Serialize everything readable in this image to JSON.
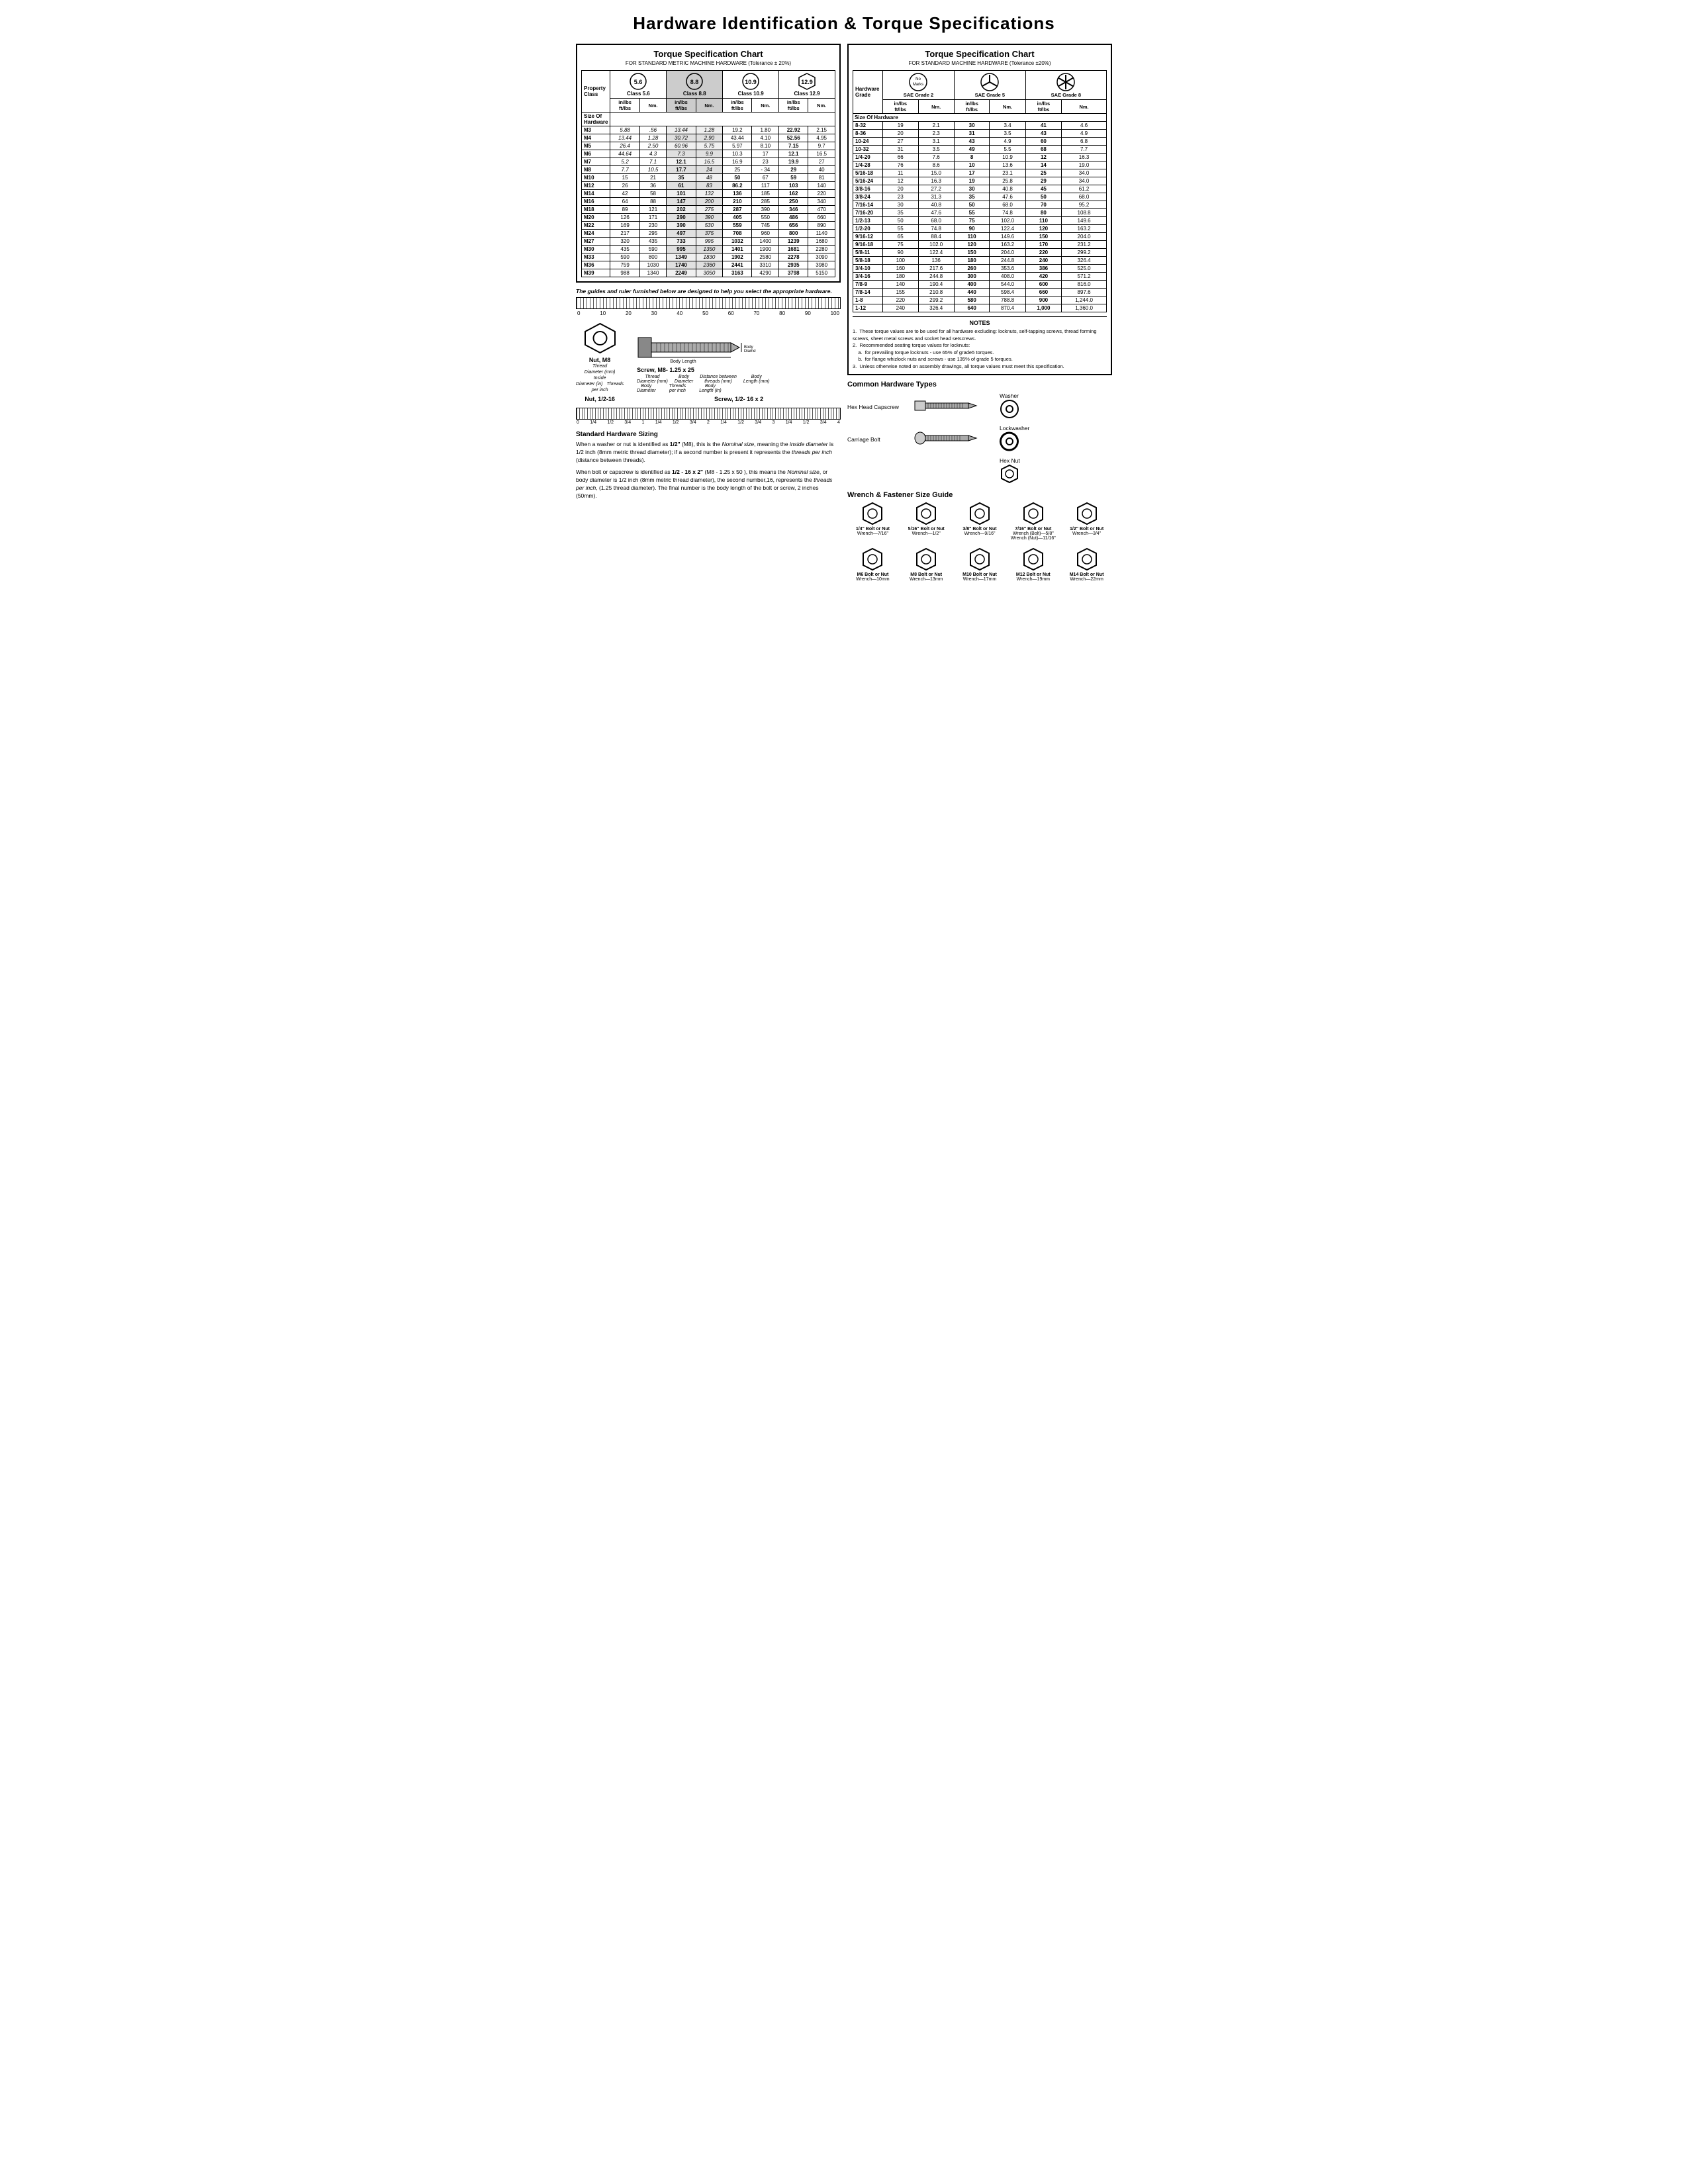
{
  "title": "Hardware Identification  &  Torque Specifications",
  "left_chart": {
    "title": "Torque Specification Chart",
    "subtitle": "FOR STANDARD METRIC MACHINE HARDWARE (Tolerance ± 20%)",
    "columns": {
      "property_class": "Property\nClass",
      "size_of_hardware": "Size Of\nHardware",
      "class56_inlbs": "in/lbs\nft/lbs",
      "class56_nm": "Nm.",
      "class88_inlbs": "in/lbs\nft/lbs",
      "class88_nm": "Nm.",
      "class109_inlbs": "in/lbs\nft/lbs",
      "class109_nm": "Nm.",
      "class129_inlbs": "in/lbs\nft/lbs",
      "class129_nm": "Nm."
    },
    "classes": [
      {
        "label": "5.6",
        "sub": "Class 5.6"
      },
      {
        "label": "8.8",
        "sub": "Class 8.8"
      },
      {
        "label": "10.9",
        "sub": "Class 10.9"
      },
      {
        "label": "12.9",
        "sub": "Class 12.9"
      }
    ],
    "rows": [
      {
        "size": "M3",
        "c56_ft": "5.88",
        "c56_nm": ".56",
        "c88_ft": "13.44",
        "c88_nm": "1.28",
        "c109_ft": "19.2",
        "c109_nm": "1.80",
        "c129_ft": "22.92",
        "c129_nm": "2.15"
      },
      {
        "size": "M4",
        "c56_ft": "13.44",
        "c56_nm": "1.28",
        "c88_ft": "30.72",
        "c88_nm": "2.90",
        "c109_ft": "43.44",
        "c109_nm": "4.10",
        "c129_ft": "52.56",
        "c129_nm": "4.95"
      },
      {
        "size": "M5",
        "c56_ft": "26.4",
        "c56_nm": "2.50",
        "c88_ft": "60.96",
        "c88_nm": "5.75",
        "c109_ft": "5.97",
        "c109_nm": "8.10",
        "c129_ft": "7.15",
        "c129_nm": "9.7"
      },
      {
        "size": "M6",
        "c56_ft": "44.64",
        "c56_nm": "4.3",
        "c88_ft": "7.3",
        "c88_nm": "9.9",
        "c109_ft": "10.3",
        "c109_nm": "17",
        "c129_ft": "12.1",
        "c129_nm": "16.5"
      },
      {
        "size": "M7",
        "c56_ft": "5.2",
        "c56_nm": "7.1",
        "c88_ft": "12.1",
        "c88_nm": "16.5",
        "c109_ft": "16.9",
        "c109_nm": "23",
        "c129_ft": "19.9",
        "c129_nm": "27",
        "bold56": true
      },
      {
        "size": "M8",
        "c56_ft": "7.7",
        "c56_nm": "10.5",
        "c88_ft": "17.7",
        "c88_nm": "24",
        "c109_ft": "25",
        "c109_nm": "- 34",
        "c129_ft": "29",
        "c129_nm": "40"
      },
      {
        "size": "M10",
        "c56_ft": "15",
        "c56_nm": "21",
        "c88_ft": "35",
        "c88_nm": "48",
        "c109_ft": "50",
        "c109_nm": "67",
        "c129_ft": "59",
        "c129_nm": "81"
      },
      {
        "size": "M12",
        "c56_ft": "26",
        "c56_nm": "36",
        "c88_ft": "61",
        "c88_nm": "83",
        "c109_ft": "86.2",
        "c109_nm": "117",
        "c129_ft": "103",
        "c129_nm": "140"
      },
      {
        "size": "M14",
        "c56_ft": "42",
        "c56_nm": "58",
        "c88_ft": "101",
        "c88_nm": "132",
        "c109_ft": "136",
        "c109_nm": "185",
        "c129_ft": "162",
        "c129_nm": "220"
      },
      {
        "size": "M16",
        "c56_ft": "64",
        "c56_nm": "88",
        "c88_ft": "147",
        "c88_nm": "200",
        "c109_ft": "210",
        "c109_nm": "285",
        "c129_ft": "250",
        "c129_nm": "340"
      },
      {
        "size": "M18",
        "c56_ft": "89",
        "c56_nm": "121",
        "c88_ft": "202",
        "c88_nm": "275",
        "c109_ft": "287",
        "c109_nm": "390",
        "c129_ft": "346",
        "c129_nm": "470"
      },
      {
        "size": "M20",
        "c56_ft": "126",
        "c56_nm": "171",
        "c88_ft": "290",
        "c88_nm": "390",
        "c109_ft": "405",
        "c109_nm": "550",
        "c129_ft": "486",
        "c129_nm": "660"
      },
      {
        "size": "M22",
        "c56_ft": "169",
        "c56_nm": "230",
        "c88_ft": "390",
        "c88_nm": "530",
        "c109_ft": "559",
        "c109_nm": "745",
        "c129_ft": "656",
        "c129_nm": "890"
      },
      {
        "size": "M24",
        "c56_ft": "217",
        "c56_nm": "295",
        "c88_ft": "497",
        "c88_nm": "375",
        "c109_ft": "708",
        "c109_nm": "960",
        "c129_ft": "800",
        "c129_nm": "1140"
      },
      {
        "size": "M27",
        "c56_ft": "320",
        "c56_nm": "435",
        "c88_ft": "733",
        "c88_nm": "995",
        "c109_ft": "1032",
        "c109_nm": "1400",
        "c129_ft": "1239",
        "c129_nm": "1680"
      },
      {
        "size": "M30",
        "c56_ft": "435",
        "c56_nm": "590",
        "c88_ft": "995",
        "c88_nm": "1350",
        "c109_ft": "1401",
        "c109_nm": "1900",
        "c129_ft": "1681",
        "c129_nm": "2280"
      },
      {
        "size": "M33",
        "c56_ft": "590",
        "c56_nm": "800",
        "c88_ft": "1349",
        "c88_nm": "1830",
        "c109_ft": "1902",
        "c109_nm": "2580",
        "c129_ft": "2278",
        "c129_nm": "3090"
      },
      {
        "size": "M36",
        "c56_ft": "759",
        "c56_nm": "1030",
        "c88_ft": "1740",
        "c88_nm": "2360",
        "c109_ft": "2441",
        "c109_nm": "3310",
        "c129_ft": "2935",
        "c129_nm": "3980"
      },
      {
        "size": "M39",
        "c56_ft": "988",
        "c56_nm": "1340",
        "c88_ft": "2249",
        "c88_nm": "3050",
        "c109_ft": "3163",
        "c109_nm": "4290",
        "c129_ft": "3798",
        "c129_nm": "5150"
      }
    ],
    "guide_text": "The guides and ruler furnished below are designed to help you select the appropriate hardware.",
    "ruler_numbers": [
      "0",
      "10",
      "20",
      "30",
      "40",
      "50",
      "60",
      "70",
      "80",
      "90",
      "100"
    ],
    "nut_label": "Nut, M8",
    "nut_sublabels": {
      "thread_dia_mm": "Thread\nDiameter (mm)",
      "inside_dia_in": "Inside\nDiameter (in)",
      "threads_per_in": "Threads\nper inch"
    },
    "nut_bottom_label": "Nut, 1/2-16",
    "screw_label": "Screw, M8- 1.25 x 25",
    "screw_sublabels": {
      "thread_dia_mm": "Thread\nDiameter (mm)",
      "body_dia": "Body\nDiameter",
      "dist_between": "Distance between\nthreads (mm)",
      "body_len_mm": "Body\nLength (mm)",
      "threads_per_in": "Threads\nper inch",
      "body_len_in": "Body\nLength (in)"
    },
    "screw_bottom_label": "Screw, 1/2- 16 x 2",
    "body_length_label": "Body Length",
    "body_diameter_label": "Body\nDiameter"
  },
  "right_chart": {
    "title": "Torque Specification Chart",
    "subtitle": "FOR STANDARD MACHINE HARDWARE (Tolerance ±20%)",
    "hardware_grade_label": "Hardware\nGrade",
    "grades": [
      {
        "label": "No\nMarks",
        "sub": "SAE Grade 2"
      },
      {
        "label": "",
        "sub": "SAE Grade 5"
      },
      {
        "label": "",
        "sub": "SAE Grade 8"
      }
    ],
    "col_headers": [
      "Size Of\nHardware",
      "in/lbs\nft/lbs",
      "Nm.",
      "in/lbs\nft/lbs",
      "Nm.",
      "in/lbs\nft/lbs",
      "Nm."
    ],
    "rows": [
      {
        "size": "8-32",
        "g2_ft": "19",
        "g2_nm": "2.1",
        "g5_ft": "30",
        "g5_nm": "3.4",
        "g8_ft": "41",
        "g8_nm": "4.6"
      },
      {
        "size": "8-36",
        "g2_ft": "20",
        "g2_nm": "2.3",
        "g5_ft": "31",
        "g5_nm": "3.5",
        "g8_ft": "43",
        "g8_nm": "4.9"
      },
      {
        "size": "10-24",
        "g2_ft": "27",
        "g2_nm": "3.1",
        "g5_ft": "43",
        "g5_nm": "4.9",
        "g8_ft": "60",
        "g8_nm": "6.8"
      },
      {
        "size": "10-32",
        "g2_ft": "31",
        "g2_nm": "3.5",
        "g5_ft": "49",
        "g5_nm": "5.5",
        "g8_ft": "68",
        "g8_nm": "7.7"
      },
      {
        "size": "1/4-20",
        "g2_ft": "66",
        "g2_nm": "7.6",
        "g5_ft": "8",
        "g5_nm": "10.9",
        "g8_ft": "12",
        "g8_nm": "16.3"
      },
      {
        "size": "1/4-28",
        "g2_ft": "76",
        "g2_nm": "8.6",
        "g5_ft": "10",
        "g5_nm": "13.6",
        "g8_ft": "14",
        "g8_nm": "19.0"
      },
      {
        "size": "5/16-18",
        "g2_ft": "11",
        "g2_nm": "15.0",
        "g5_ft": "17",
        "g5_nm": "23.1",
        "g8_ft": "25",
        "g8_nm": "34.0"
      },
      {
        "size": "5/16-24",
        "g2_ft": "12",
        "g2_nm": "16.3",
        "g5_ft": "19",
        "g5_nm": "25.8",
        "g8_ft": "29",
        "g8_nm": "34.0"
      },
      {
        "size": "3/8-16",
        "g2_ft": "20",
        "g2_nm": "27.2",
        "g5_ft": "30",
        "g5_nm": "40.8",
        "g8_ft": "45",
        "g8_nm": "61.2"
      },
      {
        "size": "3/8-24",
        "g2_ft": "23",
        "g2_nm": "31.3",
        "g5_ft": "35",
        "g5_nm": "47.6",
        "g8_ft": "50",
        "g8_nm": "68.0"
      },
      {
        "size": "7/16-14",
        "g2_ft": "30",
        "g2_nm": "40.8",
        "g5_ft": "50",
        "g5_nm": "68.0",
        "g8_ft": "70",
        "g8_nm": "95.2"
      },
      {
        "size": "7/16-20",
        "g2_ft": "35",
        "g2_nm": "47.6",
        "g5_ft": "55",
        "g5_nm": "74.8",
        "g8_ft": "80",
        "g8_nm": "108.8"
      },
      {
        "size": "1/2-13",
        "g2_ft": "50",
        "g2_nm": "68.0",
        "g5_ft": "75",
        "g5_nm": "102.0",
        "g8_ft": "110",
        "g8_nm": "149.6"
      },
      {
        "size": "1/2-20",
        "g2_ft": "55",
        "g2_nm": "74.8",
        "g5_ft": "90",
        "g5_nm": "122.4",
        "g8_ft": "120",
        "g8_nm": "163.2"
      },
      {
        "size": "9/16-12",
        "g2_ft": "65",
        "g2_nm": "88.4",
        "g5_ft": "110",
        "g5_nm": "149.6",
        "g8_ft": "150",
        "g8_nm": "204.0"
      },
      {
        "size": "9/16-18",
        "g2_ft": "75",
        "g2_nm": "102.0",
        "g5_ft": "120",
        "g5_nm": "163.2",
        "g8_ft": "170",
        "g8_nm": "231.2"
      },
      {
        "size": "5/8-11",
        "g2_ft": "90",
        "g2_nm": "122.4",
        "g5_ft": "150",
        "g5_nm": "204.0",
        "g8_ft": "220",
        "g8_nm": "299.2"
      },
      {
        "size": "5/8-18",
        "g2_ft": "100",
        "g2_nm": "136",
        "g5_ft": "180",
        "g5_nm": "244.8",
        "g8_ft": "240",
        "g8_nm": "326.4"
      },
      {
        "size": "3/4-10",
        "g2_ft": "160",
        "g2_nm": "217.6",
        "g5_ft": "260",
        "g5_nm": "353.6",
        "g8_ft": "386",
        "g8_nm": "525.0"
      },
      {
        "size": "3/4-16",
        "g2_ft": "180",
        "g2_nm": "244.8",
        "g5_ft": "300",
        "g5_nm": "408.0",
        "g8_ft": "420",
        "g8_nm": "571.2"
      },
      {
        "size": "7/8-9",
        "g2_ft": "140",
        "g2_nm": "190.4",
        "g5_ft": "400",
        "g5_nm": "544.0",
        "g8_ft": "600",
        "g8_nm": "816.0"
      },
      {
        "size": "7/8-14",
        "g2_ft": "155",
        "g2_nm": "210.8",
        "g5_ft": "440",
        "g5_nm": "598.4",
        "g8_ft": "660",
        "g8_nm": "897.6"
      },
      {
        "size": "1-8",
        "g2_ft": "220",
        "g2_nm": "299.2",
        "g5_ft": "580",
        "g5_nm": "788.8",
        "g8_ft": "900",
        "g8_nm": "1,244.0"
      },
      {
        "size": "1-12",
        "g2_ft": "240",
        "g2_nm": "326.4",
        "g5_ft": "640",
        "g5_nm": "870.4",
        "g8_ft": "1,000",
        "g8_nm": "1,360.0"
      }
    ],
    "notes": {
      "title": "NOTES",
      "items": [
        "These torque values are to be used for all hardware excluding: locknuts, self-tapping screws, thread forming screws, sheet metal screws and socket head setscrews.",
        "Recommended seating torque values for locknuts:",
        "a.  for prevailing torque locknuts - use 65% of grade5 torques.",
        "b.  for flange whizlock nuts and screws - use 135% of grade 5 torques.",
        "Unless otherwise noted on assembly drawings, all torque values must meet this specification."
      ]
    }
  },
  "bottom_left": {
    "standard_sizing_title": "Standard Hardware Sizing",
    "para1": "When a washer or nut is identified as 1/2\" (M8), this is the Nominal size, meaning the inside diameter is 1/2 inch (8mm metric thread diameter); if a second number is present it represents the threads per inch (distance between threads).",
    "para2": "When bolt or capscrew is identified as 1/2 - 16 x 2\" (M8 - 1.25 x 50), this means the Nominal size, or body diameter is 1/2 inch (8mm metric thread diameter), the second number,16, represents the threads per inch, (1.25 thread diameter). The final number is the body length of the bolt or screw, 2 inches (50mm)."
  },
  "bottom_right": {
    "common_hardware_title": "Common Hardware Types",
    "hardware_types": [
      {
        "label": "Hex Head Capscrew"
      },
      {
        "label": "Washer"
      },
      {
        "label": "Carriage Bolt"
      },
      {
        "label": "Lockwasher"
      },
      {
        "label": "Hex Nut"
      }
    ],
    "wrench_guide_title": "Wrench & Fastener Size Guide",
    "wrench_items": [
      {
        "bolt": "1/4\" Bolt or Nut",
        "wrench": "Wrench—7/16\""
      },
      {
        "bolt": "5/16\" Bolt or Nut",
        "wrench": "Wrench—1/2\""
      },
      {
        "bolt": "3/8\" Bolt or Nut",
        "wrench": "Wrench—9/16\""
      },
      {
        "bolt": "7/16\" Bolt or Nut",
        "wrench": "Wrench (Bolt)—5/8\"\nWrench (Nut)—11/16\""
      },
      {
        "bolt": "1/2\" Bolt or Nut",
        "wrench": "Wrench—3/4\""
      },
      {
        "bolt": "M6 Bolt or Nut",
        "wrench": "Wrench—10mm"
      },
      {
        "bolt": "M8 Bolt or Nut",
        "wrench": "Wrench—13mm"
      },
      {
        "bolt": "M10 Bolt or Nut",
        "wrench": "Wrench—17mm"
      },
      {
        "bolt": "M12 Bolt or Nut",
        "wrench": "Wrench—19mm"
      },
      {
        "bolt": "M14 Bolt or Nut",
        "wrench": "Wrench—22mm"
      }
    ]
  },
  "colors": {
    "border": "#000000",
    "text": "#000000",
    "background": "#ffffff",
    "header_bg": "#e8e8e8"
  }
}
